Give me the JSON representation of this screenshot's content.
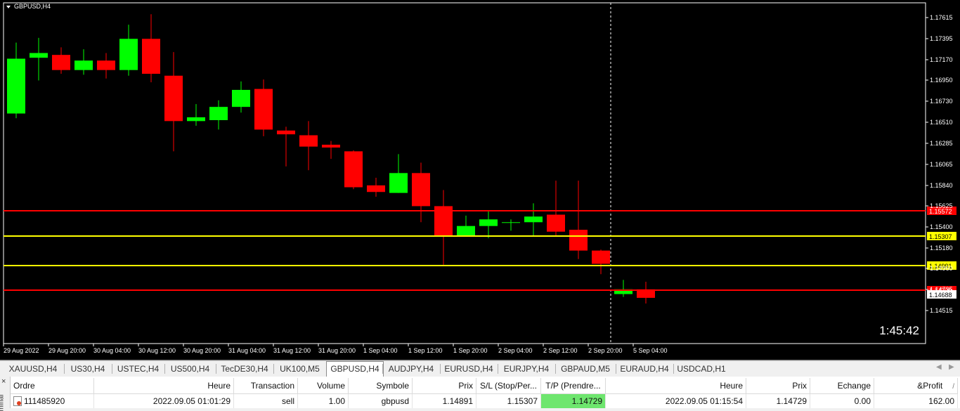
{
  "chart": {
    "symbol_label": "GBPUSD,H4",
    "countdown": "1:45:42",
    "colors": {
      "bull": "#00ff00",
      "bear": "#ff0000",
      "sl_line": "#ff0000",
      "tp_line": "#ffff00",
      "grid_bg": "#000000",
      "axis_text": "#ffffff"
    },
    "price_axis_ticks": [
      "1.17615",
      "1.17395",
      "1.17170",
      "1.16950",
      "1.16730",
      "1.16510",
      "1.16285",
      "1.16065",
      "1.15840",
      "1.15625",
      "1.15400",
      "1.15180",
      "1.14960",
      "1.14735",
      "1.14515"
    ],
    "time_axis_labels": [
      "29 Aug 2022",
      "29 Aug 20:00",
      "30 Aug 04:00",
      "30 Aug 12:00",
      "30 Aug 20:00",
      "31 Aug 04:00",
      "31 Aug 12:00",
      "31 Aug 20:00",
      "1 Sep 04:00",
      "1 Sep 12:00",
      "1 Sep 20:00",
      "2 Sep 04:00",
      "2 Sep 12:00",
      "2 Sep 20:00",
      "5 Sep 04:00"
    ],
    "level_lines": [
      {
        "price": 1.15572,
        "label": "1.15572",
        "kind": "red"
      },
      {
        "price": 1.15307,
        "label": "1.15307",
        "kind": "yellow"
      },
      {
        "price": 1.14991,
        "label": "1.14991",
        "kind": "yellow"
      },
      {
        "price": 1.14729,
        "label": "1.14729",
        "kind": "red"
      },
      {
        "price": 1.14688,
        "label": "1.14688",
        "kind": "bid"
      }
    ],
    "candles": [
      {
        "o": 1.166,
        "h": 1.1735,
        "l": 1.1655,
        "c": 1.1718
      },
      {
        "o": 1.1719,
        "h": 1.174,
        "l": 1.1695,
        "c": 1.1724
      },
      {
        "o": 1.1722,
        "h": 1.173,
        "l": 1.1702,
        "c": 1.1706
      },
      {
        "o": 1.1706,
        "h": 1.1728,
        "l": 1.1701,
        "c": 1.1716
      },
      {
        "o": 1.1716,
        "h": 1.1724,
        "l": 1.1697,
        "c": 1.1706
      },
      {
        "o": 1.1706,
        "h": 1.1754,
        "l": 1.17,
        "c": 1.1739
      },
      {
        "o": 1.1739,
        "h": 1.1765,
        "l": 1.1693,
        "c": 1.1702
      },
      {
        "o": 1.17,
        "h": 1.1725,
        "l": 1.162,
        "c": 1.1652
      },
      {
        "o": 1.1652,
        "h": 1.167,
        "l": 1.1647,
        "c": 1.1656
      },
      {
        "o": 1.1653,
        "h": 1.1674,
        "l": 1.1643,
        "c": 1.1667
      },
      {
        "o": 1.1667,
        "h": 1.1694,
        "l": 1.1661,
        "c": 1.1685
      },
      {
        "o": 1.1686,
        "h": 1.1696,
        "l": 1.1636,
        "c": 1.1643
      },
      {
        "o": 1.1642,
        "h": 1.1646,
        "l": 1.1604,
        "c": 1.1638
      },
      {
        "o": 1.1637,
        "h": 1.1652,
        "l": 1.16,
        "c": 1.1625
      },
      {
        "o": 1.1627,
        "h": 1.1631,
        "l": 1.1612,
        "c": 1.1624
      },
      {
        "o": 1.162,
        "h": 1.1621,
        "l": 1.158,
        "c": 1.1582
      },
      {
        "o": 1.1584,
        "h": 1.1592,
        "l": 1.1572,
        "c": 1.1577
      },
      {
        "o": 1.1576,
        "h": 1.1617,
        "l": 1.1576,
        "c": 1.1597
      },
      {
        "o": 1.1597,
        "h": 1.1608,
        "l": 1.1545,
        "c": 1.1562
      },
      {
        "o": 1.1562,
        "h": 1.1579,
        "l": 1.15,
        "c": 1.153
      },
      {
        "o": 1.1531,
        "h": 1.1552,
        "l": 1.153,
        "c": 1.1541
      },
      {
        "o": 1.1541,
        "h": 1.1557,
        "l": 1.1528,
        "c": 1.1548
      },
      {
        "o": 1.1545,
        "h": 1.1548,
        "l": 1.1536,
        "c": 1.1545
      },
      {
        "o": 1.1545,
        "h": 1.1565,
        "l": 1.153,
        "c": 1.1551
      },
      {
        "o": 1.1553,
        "h": 1.1589,
        "l": 1.1531,
        "c": 1.1535
      },
      {
        "o": 1.1537,
        "h": 1.1589,
        "l": 1.1506,
        "c": 1.1515
      },
      {
        "o": 1.1515,
        "h": 1.1516,
        "l": 1.149,
        "c": 1.1501
      },
      {
        "o": 1.1469,
        "h": 1.1484,
        "l": 1.1466,
        "c": 1.1474
      },
      {
        "o": 1.1474,
        "h": 1.1482,
        "l": 1.1459,
        "c": 1.1465
      }
    ]
  },
  "tabs": [
    "XAUUSD,H4",
    "US30,H4",
    "USTEC,H4",
    "US500,H4",
    "TecDE30,H4",
    "UK100,M5",
    "GBPUSD,H4",
    "AUDJPY,H4",
    "EURUSD,H4",
    "EURJPY,H4",
    "GBPAUD,M5",
    "EURAUD,H4",
    "USDCAD,H1"
  ],
  "active_tab": "GBPUSD,H4",
  "terminal": {
    "close_glyph": "×",
    "side_label": "minal",
    "columns": [
      "Ordre",
      "Heure",
      "Transaction",
      "Volume",
      "Symbole",
      "Prix",
      "S/L (Stop/Per...",
      "T/P (Prendre...",
      "Heure",
      "Prix",
      "Echange",
      "&Profit"
    ],
    "profit_sort_glyph": "/",
    "rows": [
      [
        "111485920",
        "2022.09.05 01:01:29",
        "sell",
        "1.00",
        "gbpusd",
        "1.14891",
        "1.15307",
        "1.14729",
        "2022.09.05 01:15:54",
        "1.14729",
        "0.00",
        "162.00"
      ]
    ]
  }
}
